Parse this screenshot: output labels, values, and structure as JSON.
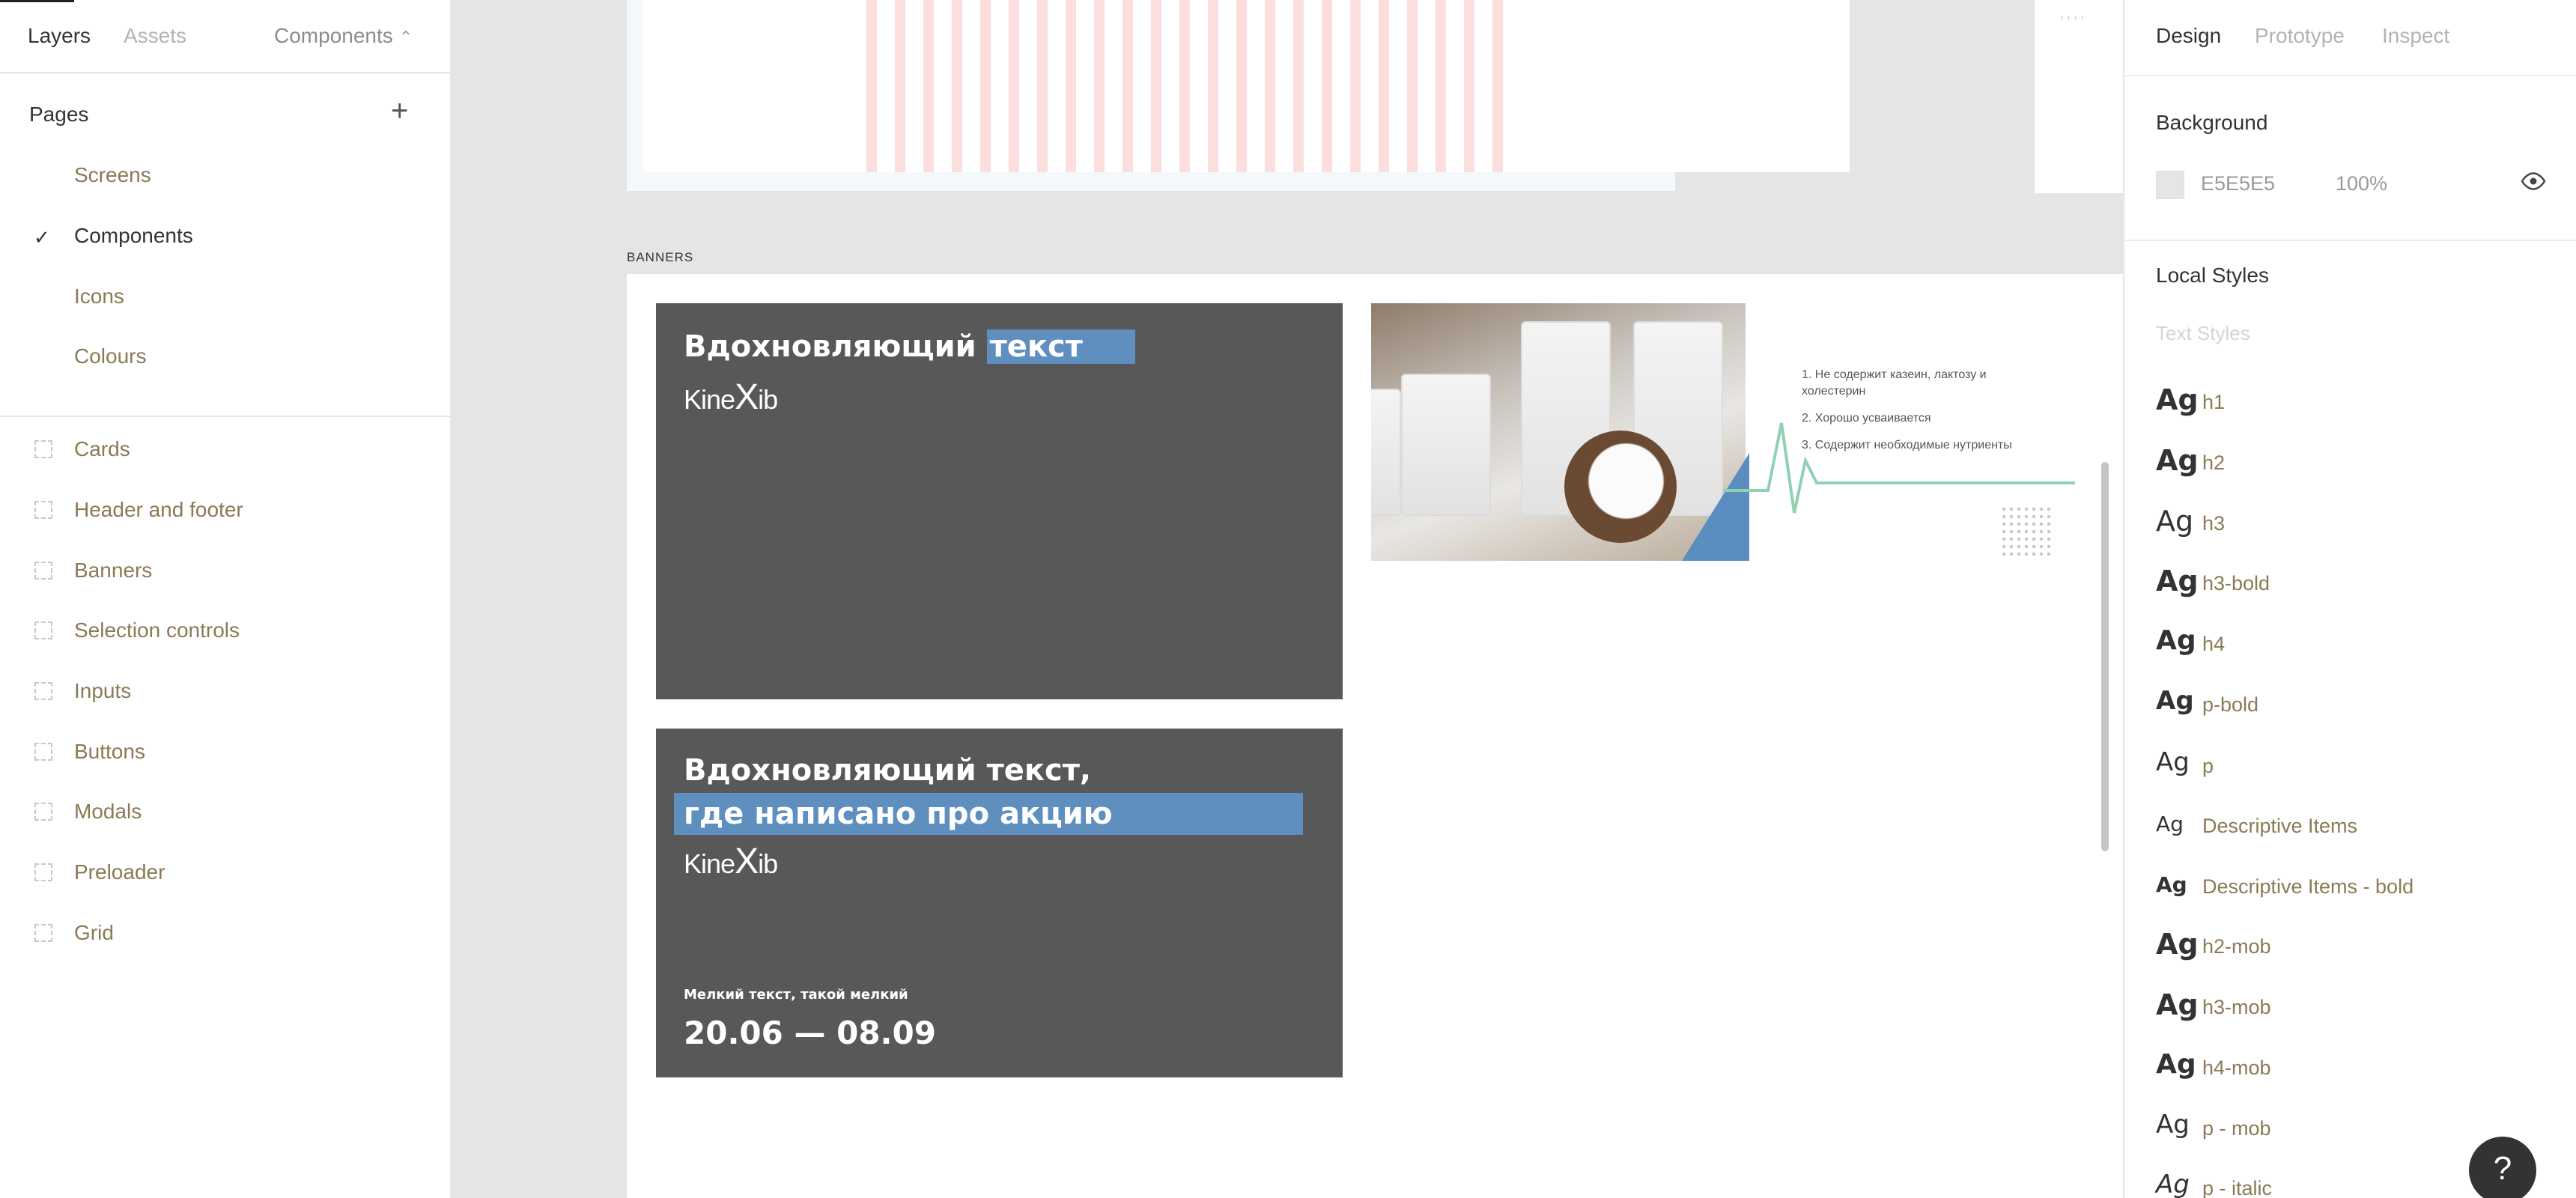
{
  "left_panel": {
    "tabs": {
      "layers": "Layers",
      "assets": "Assets",
      "components": "Components"
    },
    "pages_title": "Pages",
    "add_icon": "plus-icon",
    "pages": [
      "Screens",
      "Components",
      "Icons",
      "Colours"
    ],
    "current_page": "Components",
    "layers": [
      "Cards",
      "Header and footer",
      "Banners",
      "Selection controls",
      "Inputs",
      "Buttons",
      "Modals",
      "Preloader",
      "Grid"
    ]
  },
  "canvas": {
    "frame_label": "BANNERS",
    "banner1": {
      "headline_plain": "Вдохновляющий ",
      "headline_highlight": "текст",
      "logo_left": "Kine",
      "logo_x": "X",
      "logo_right": "ib"
    },
    "banner2": {
      "line1": "Вдохновляющий текст,",
      "line2": "где написано про акцию",
      "logo_left": "Kine",
      "logo_x": "X",
      "logo_right": "ib",
      "small_text": "Мелкий текст, такой мелкий",
      "date": "20.06 — 08.09"
    },
    "milk_banner": {
      "items": [
        "1. Не содержит казеин, лактозу и холестерин",
        "2. Хорошо усваивается",
        "3. Содержит необходимые нутриенты"
      ]
    },
    "colors": {
      "banner_bg": "#585858",
      "highlight": "#5e8fbf",
      "pulse": "#8fd1b3"
    }
  },
  "right_panel": {
    "tabs": {
      "design": "Design",
      "prototype": "Prototype",
      "inspect": "Inspect"
    },
    "background_title": "Background",
    "background_hex": "E5E5E5",
    "background_opacity": "100%",
    "local_styles_title": "Local Styles",
    "text_styles_title": "Text Styles",
    "sample": "Ag",
    "styles": [
      "h1",
      "h2",
      "h3",
      "h3-bold",
      "h4",
      "p-bold",
      "p",
      "Descriptive Items",
      "Descriptive Items - bold",
      "h2-mob",
      "h3-mob",
      "h4-mob",
      "p - mob",
      "p - italic"
    ],
    "help_label": "?"
  }
}
